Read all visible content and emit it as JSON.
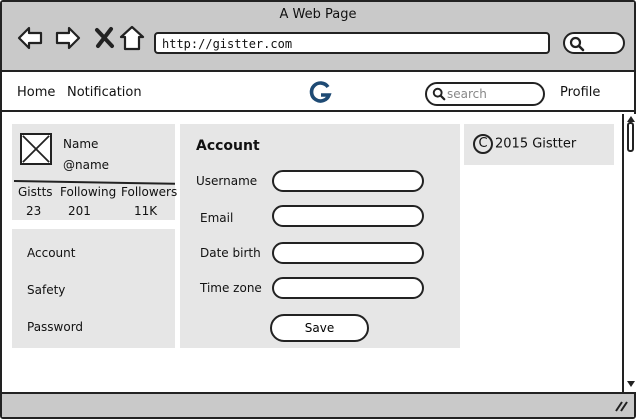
{
  "window": {
    "title": "A Web Page"
  },
  "browser": {
    "url": "http://gistter.com"
  },
  "site_nav": {
    "home": "Home",
    "notification": "Notification",
    "logo_letter": "G",
    "search_placeholder": "search",
    "profile": "Profile"
  },
  "profile_card": {
    "name": "Name",
    "handle": "@name",
    "stats_labels": [
      "Gistts",
      "Following",
      "Followers"
    ],
    "stats_values": [
      "23",
      "201",
      "11K"
    ]
  },
  "settings_menu": [
    "Account",
    "Safety",
    "Password"
  ],
  "account_form": {
    "title": "Account",
    "fields": [
      {
        "label": "Username",
        "value": ""
      },
      {
        "label": "Email",
        "value": ""
      },
      {
        "label": "Date birth",
        "value": ""
      },
      {
        "label": "Time zone",
        "value": ""
      }
    ],
    "save_label": "Save"
  },
  "footer": {
    "copyright_symbol": "C",
    "copyright_text": "2015 Gistter"
  },
  "icons": {
    "back": "arrow-left-icon",
    "forward": "arrow-right-icon",
    "stop": "close-icon",
    "home": "home-icon",
    "search": "search-icon",
    "logo": "gistter-logo-icon",
    "avatar": "image-placeholder-icon",
    "resize": "resize-grip-icon"
  },
  "colors": {
    "chrome": "#c9c9c9",
    "panel": "#e6e6e6",
    "logo": "#1e4a74",
    "stroke": "#222222"
  }
}
